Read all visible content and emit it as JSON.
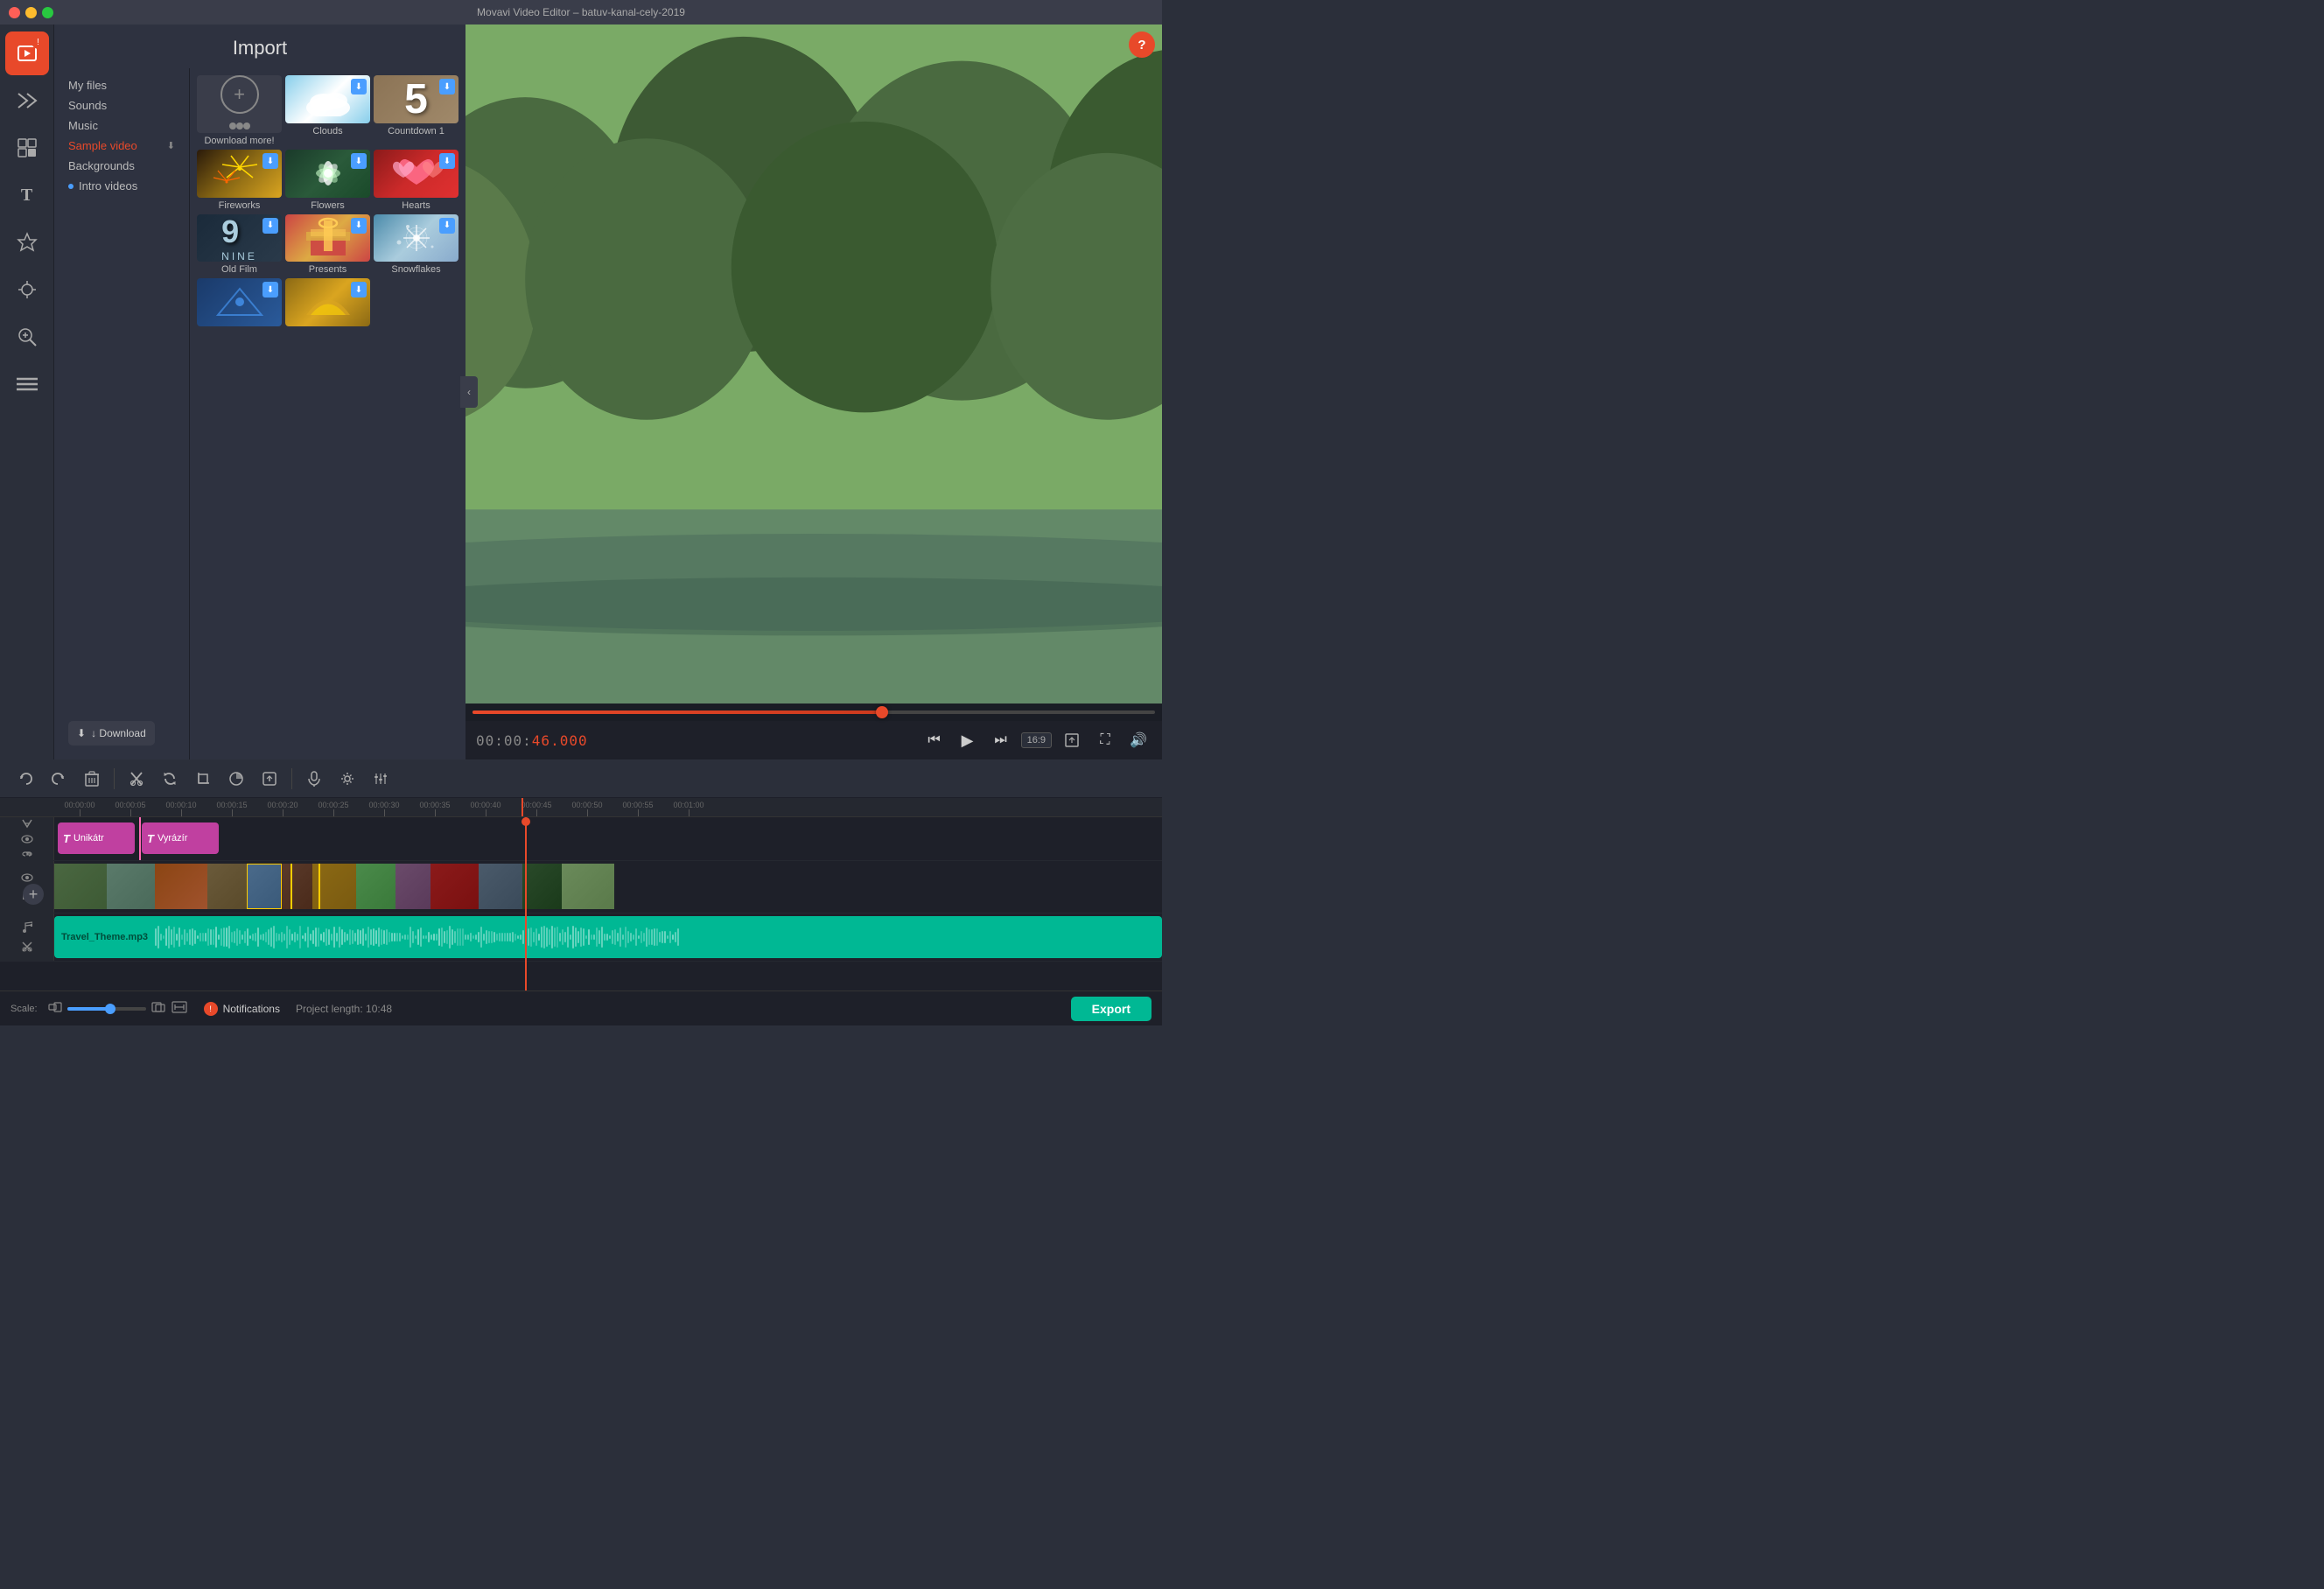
{
  "app": {
    "title": "Movavi Video Editor – batuv-kanal-cely-2019",
    "help_label": "?"
  },
  "sidebar": {
    "items": [
      {
        "id": "media",
        "icon": "🎬",
        "label": "Media",
        "active": true,
        "badge": "!"
      },
      {
        "id": "transitions",
        "icon": "✨",
        "label": "Transitions",
        "active": false
      },
      {
        "id": "filters",
        "icon": "🎞",
        "label": "Filters",
        "active": false
      },
      {
        "id": "text",
        "icon": "T",
        "label": "Text",
        "active": false
      },
      {
        "id": "stickers",
        "icon": "⭐",
        "label": "Stickers",
        "active": false
      },
      {
        "id": "effects",
        "icon": "🔀",
        "label": "Effects",
        "active": false
      },
      {
        "id": "zoom",
        "icon": "🔍",
        "label": "Zoom",
        "active": false
      },
      {
        "id": "menu",
        "icon": "☰",
        "label": "Menu",
        "active": false
      }
    ]
  },
  "import": {
    "title": "Import",
    "tree": [
      {
        "id": "my-files",
        "label": "My files",
        "active": false
      },
      {
        "id": "sounds",
        "label": "Sounds",
        "active": false
      },
      {
        "id": "music",
        "label": "Music",
        "active": false
      },
      {
        "id": "sample-video",
        "label": "Sample video",
        "active": true
      },
      {
        "id": "backgrounds",
        "label": "Backgrounds",
        "active": false
      },
      {
        "id": "intro-videos",
        "label": "Intro videos",
        "active": false,
        "dot": true
      }
    ],
    "download_btn": "↓ Download",
    "media_items": [
      {
        "id": "download-more",
        "label": "Download more!",
        "type": "download-more"
      },
      {
        "id": "clouds",
        "label": "Clouds",
        "type": "clouds",
        "has_badge": true
      },
      {
        "id": "countdown1",
        "label": "Countdown 1",
        "type": "countdown",
        "has_badge": true,
        "number": "5"
      },
      {
        "id": "fireworks",
        "label": "Fireworks",
        "type": "fireworks",
        "has_badge": true
      },
      {
        "id": "flowers",
        "label": "Flowers",
        "type": "flowers",
        "has_badge": true
      },
      {
        "id": "hearts",
        "label": "Hearts",
        "type": "hearts",
        "has_badge": true
      },
      {
        "id": "oldfilm",
        "label": "Old Film",
        "type": "oldfilm",
        "has_badge": true,
        "number": "9"
      },
      {
        "id": "presents",
        "label": "Presents",
        "type": "presents",
        "has_badge": true
      },
      {
        "id": "snowflakes",
        "label": "Snowflakes",
        "type": "snowflakes",
        "has_badge": true
      },
      {
        "id": "blue",
        "label": "",
        "type": "blue",
        "has_badge": true
      },
      {
        "id": "gold",
        "label": "",
        "type": "gold",
        "has_badge": true
      }
    ]
  },
  "transport": {
    "timecode": "00:00:46.000",
    "timecode_prefix": "00:00:",
    "timecode_frames": "46.000",
    "aspect_ratio": "16:9",
    "play_label": "▶",
    "prev_label": "⏮",
    "next_label": "⏭"
  },
  "toolbar": {
    "undo": "↩",
    "redo": "↪",
    "delete": "🗑",
    "cut": "✂",
    "rotate": "↻",
    "crop": "⊡",
    "color": "◑",
    "export_frame": "⬜",
    "audio": "🎤",
    "settings": "⚙",
    "equalizer": "≡"
  },
  "timeline": {
    "ruler_marks": [
      "00:00:00",
      "00:00:05",
      "00:00:10",
      "00:00:15",
      "00:00:20",
      "00:00:25",
      "00:00:30",
      "00:00:35",
      "00:00:40",
      "00:00:45",
      "00:00:50",
      "00:00:55",
      "00:01:00"
    ],
    "tracks": [
      {
        "id": "text-track",
        "type": "text",
        "clips": [
          {
            "label": "Unikátr",
            "start": 0,
            "width": 90
          },
          {
            "label": "Vyrázír",
            "start": 92,
            "width": 90
          }
        ]
      },
      {
        "id": "video-track",
        "type": "video"
      },
      {
        "id": "audio-track",
        "type": "audio",
        "label": "Travel_Theme.mp3"
      }
    ],
    "playhead_position": "60%"
  },
  "bottom_bar": {
    "scale_label": "Scale:",
    "notifications_label": "Notifications",
    "project_length_label": "Project length:",
    "project_length": "10:48",
    "export_label": "Export"
  }
}
